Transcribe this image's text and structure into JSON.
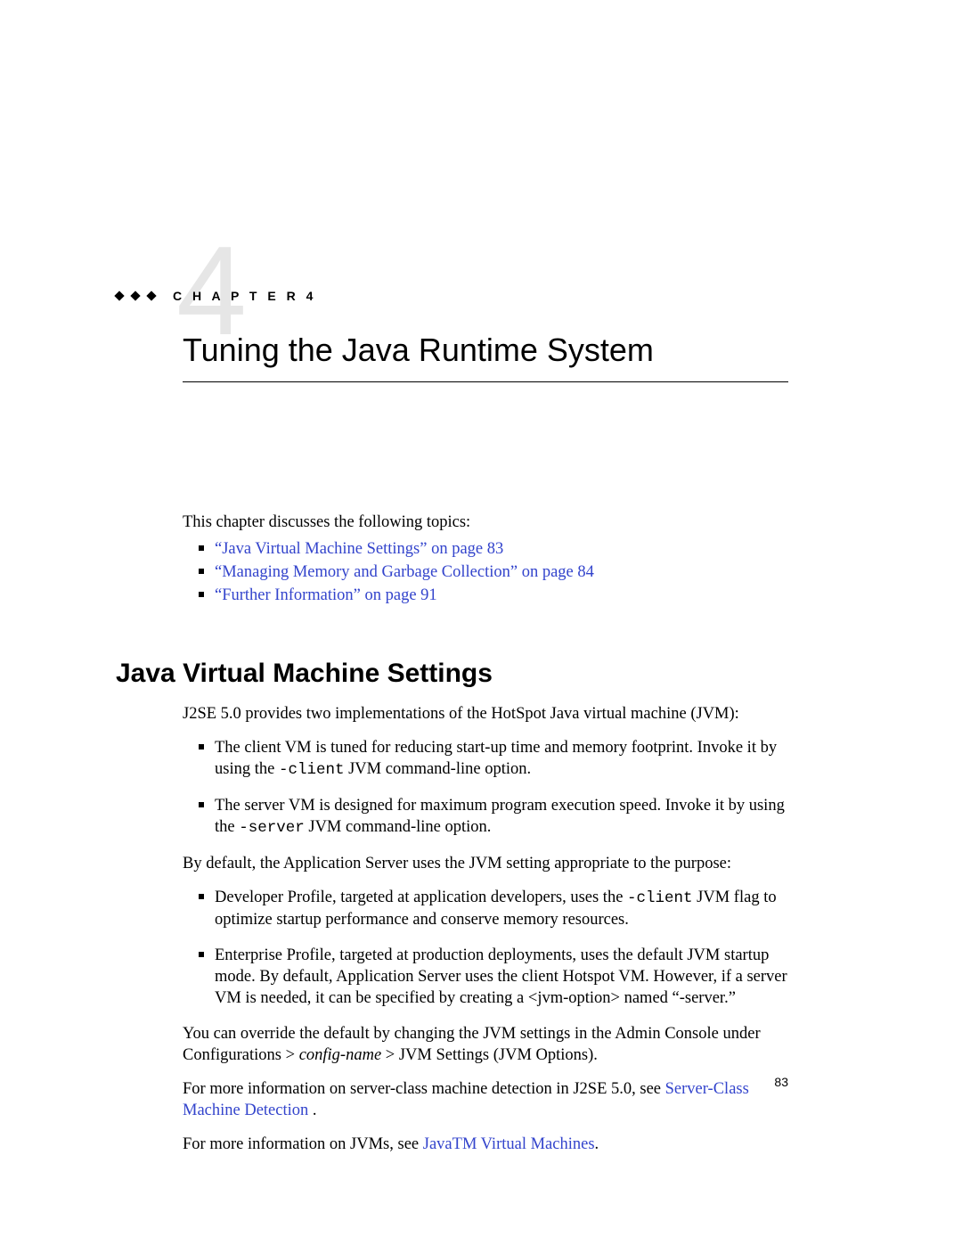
{
  "chapter": {
    "label": "C H A P T E R   4",
    "big_number": "4",
    "title": "Tuning the Java Runtime System"
  },
  "intro": "This chapter discusses the following topics:",
  "toc": [
    "“Java Virtual Machine Settings” on page 83",
    "“Managing Memory and Garbage Collection” on page 84",
    "“Further Information” on page 91"
  ],
  "section": {
    "title": "Java Virtual Machine Settings",
    "p1": "J2SE 5.0 provides two implementations of the HotSpot Java virtual machine (JVM):",
    "bullets1": [
      {
        "a": "The client VM is tuned for reducing start-up time and memory footprint. Invoke it by using the ",
        "code": "-client",
        "b": " JVM command-line option."
      },
      {
        "a": "The server VM is designed for maximum program execution speed. Invoke it by using the ",
        "code": "-server",
        "b": " JVM command-line option."
      }
    ],
    "p2": "By default, the Application Server uses the JVM setting appropriate to the purpose:",
    "bullets2": [
      {
        "a": "Developer Profile, targeted at application developers, uses the ",
        "code": "-client",
        "b": " JVM flag to optimize startup performance and conserve memory resources."
      },
      {
        "a": "Enterprise Profile, targeted at production deployments, uses the default JVM startup mode. By default, Application Server uses the client Hotspot VM. However, if a server VM is needed, it can be specified by creating a <jvm-option> named “-server.”",
        "code": "",
        "b": ""
      }
    ],
    "p3a": "You can override the default by changing the JVM settings in the Admin Console under Configurations > ",
    "p3i": "config-name",
    "p3b": " > JVM Settings (JVM Options).",
    "p4a": "For more information on server-class machine detection in J2SE 5.0, see ",
    "p4link": "Server-Class Machine Detection",
    "p4b": " .",
    "p5a": "For more information on JVMs, see ",
    "p5link": "JavaTM Virtual Machines",
    "p5b": "."
  },
  "page_number": "83"
}
